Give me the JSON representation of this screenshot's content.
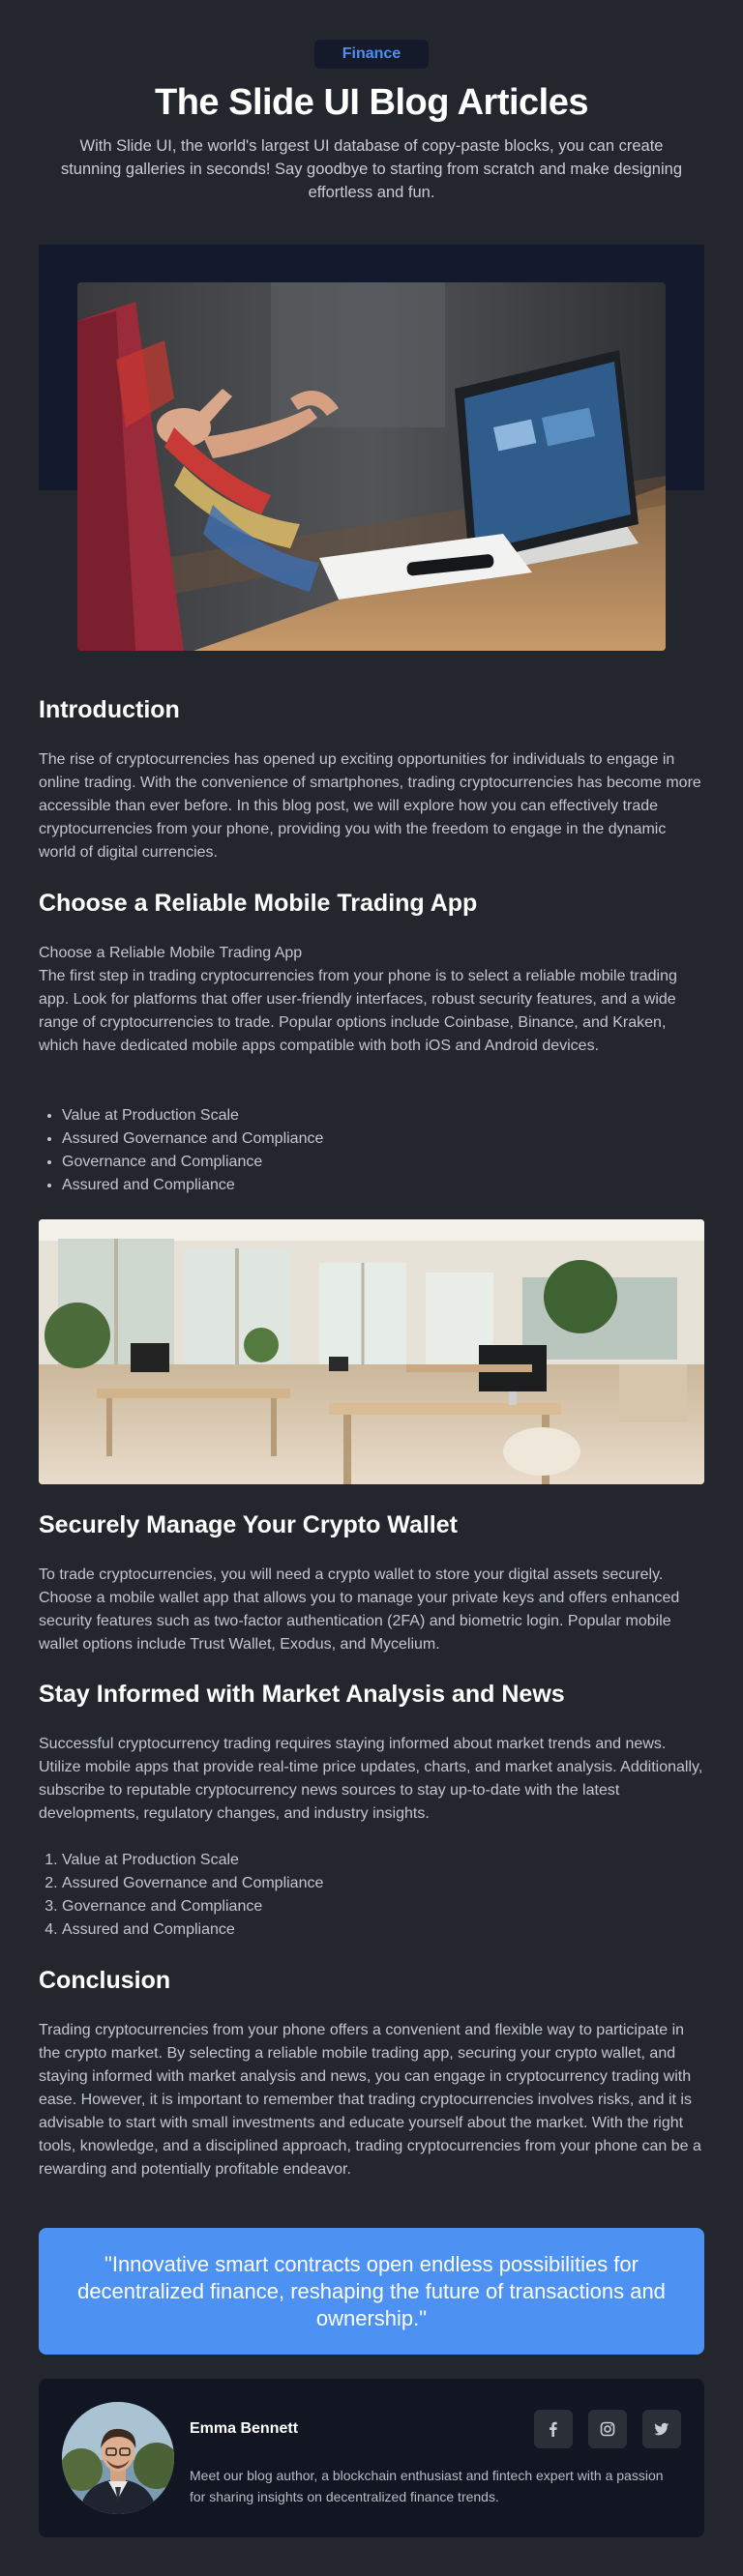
{
  "header": {
    "badge": "Finance",
    "title": "The Slide UI Blog Articles",
    "subtitle": "With Slide UI, the world's largest UI database of copy-paste blocks, you can create stunning galleries in seconds! Say goodbye to starting from scratch and make designing effortless and fun."
  },
  "sections": {
    "intro": {
      "heading": "Introduction",
      "body": "The rise of cryptocurrencies has opened up exciting opportunities for individuals to engage in online trading. With the convenience of smartphones, trading cryptocurrencies has become more accessible than ever before. In this blog post, we will explore how you can effectively trade cryptocurrencies from your phone, providing you with the freedom to engage in the dynamic world of digital currencies."
    },
    "app": {
      "heading": "Choose a Reliable Mobile Trading App",
      "subheading": "Choose a Reliable Mobile Trading App",
      "body": "The first step in trading cryptocurrencies from your phone is to select a reliable mobile trading app. Look for platforms that offer user-friendly interfaces, robust security features, and a wide range of cryptocurrencies to trade. Popular options include Coinbase, Binance, and Kraken, which have dedicated mobile apps compatible with both iOS and Android devices.",
      "bullets": [
        "Value at Production Scale",
        "Assured Governance and Compliance",
        "Governance and Compliance",
        "Assured and Compliance"
      ]
    },
    "wallet": {
      "heading": "Securely Manage Your Crypto Wallet",
      "body": "To trade cryptocurrencies, you will need a crypto wallet to store your digital assets securely. Choose a mobile wallet app that allows you to manage your private keys and offers enhanced security features such as two-factor authentication (2FA) and biometric login. Popular mobile wallet options include Trust Wallet, Exodus, and Mycelium."
    },
    "news": {
      "heading": "Stay Informed with Market Analysis and News",
      "body": "Successful cryptocurrency trading requires staying informed about market trends and news. Utilize mobile apps that provide real-time price updates, charts, and market analysis. Additionally, subscribe to reputable cryptocurrency news sources to stay up-to-date with the latest developments, regulatory changes, and industry insights.",
      "numbered": [
        "Value at Production Scale",
        "Assured Governance and Compliance",
        "Governance and Compliance",
        "Assured and Compliance"
      ]
    },
    "conclusion": {
      "heading": "Conclusion",
      "body": "Trading cryptocurrencies from your phone offers a convenient and flexible way to participate in the crypto market. By selecting a reliable mobile trading app, securing your crypto wallet, and staying informed with market analysis and news, you can engage in cryptocurrency trading with ease. However, it is important to remember that trading cryptocurrencies involves risks, and it is advisable to start with small investments and educate yourself about the market. With the right tools, knowledge, and a disciplined approach, trading cryptocurrencies from your phone can be a rewarding and potentially profitable endeavor."
    }
  },
  "quote": "\"Innovative smart contracts open endless possibilities for decentralized finance, reshaping the future of transactions and ownership.\"",
  "author": {
    "name": "Emma Bennett",
    "bio": "Meet our blog author, a blockchain enthusiast and fintech expert with a passion for sharing insights on decentralized finance trends.",
    "social": [
      "facebook-icon",
      "instagram-icon",
      "twitter-icon"
    ]
  },
  "colors": {
    "background": "#23272d",
    "accent": "#4d92f3",
    "badge_text": "#4d8ff5",
    "card": "#121522"
  }
}
